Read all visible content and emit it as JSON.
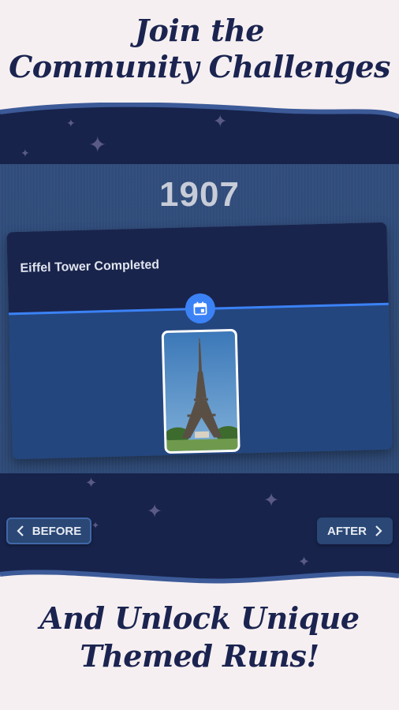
{
  "headline_top": {
    "line1": "Join the",
    "line2": "Community Challenges"
  },
  "headline_bottom": {
    "line1": "And Unlock Unique",
    "line2": "Themed Runs!"
  },
  "timeline": {
    "year": "1907",
    "event_title": "Eiffel Tower Completed",
    "badge_icon": "calendar-icon",
    "accent_color": "#3b82f6"
  },
  "nav": {
    "before_label": "BEFORE",
    "after_label": "AFTER",
    "before_icon": "chevron-left-icon",
    "after_icon": "chevron-right-icon"
  },
  "colors": {
    "background": "#f6eff1",
    "band": "#17234b",
    "panel": "#2d4a7a",
    "text_dark": "#1b2450"
  }
}
